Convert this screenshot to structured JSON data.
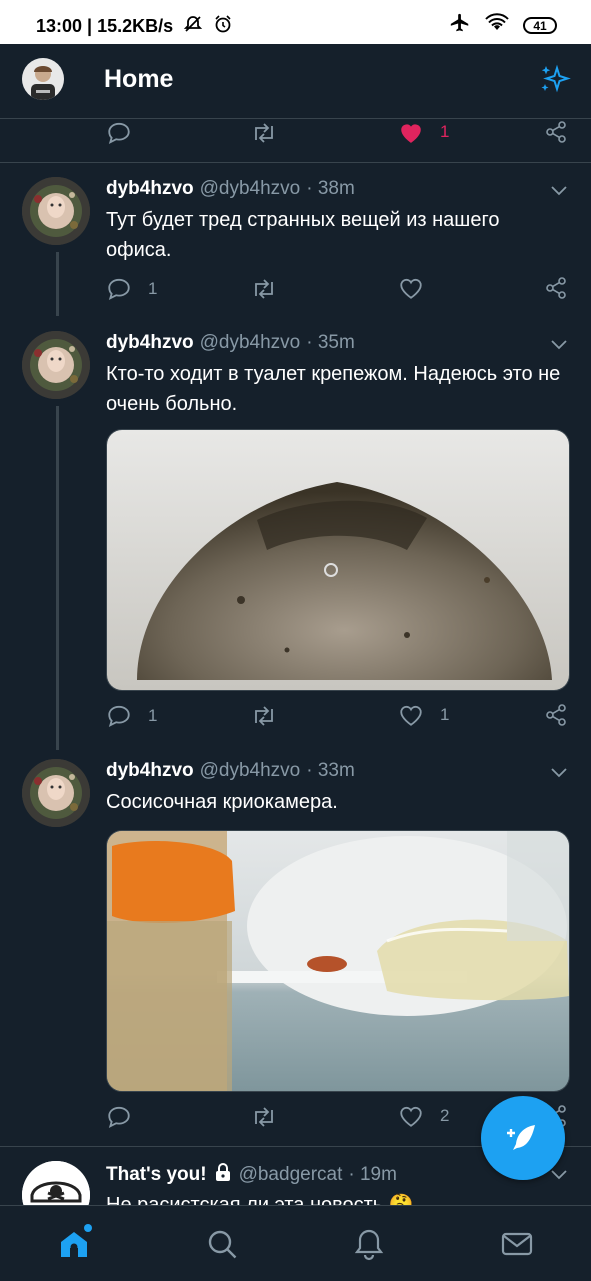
{
  "status_bar": {
    "time_speed": "13:00 | 15.2KB/s",
    "battery": "41",
    "icons": [
      "muted-bell-icon",
      "alarm-icon",
      "airplane-icon",
      "wifi-icon",
      "battery-icon"
    ]
  },
  "header": {
    "title": "Home",
    "icons": [
      "profile-avatar",
      "sparkle-icon"
    ]
  },
  "top_actions": {
    "like_count": "1"
  },
  "tweets": [
    {
      "name": "dyb4hzvo",
      "handle": "@dyb4hzvo",
      "time": "· 38m",
      "text": "Тут будет тред странных вещей из нашего офиса.",
      "reply_count": "1",
      "retweet_count": "",
      "like_count": ""
    },
    {
      "name": "dyb4hzvo",
      "handle": "@dyb4hzvo",
      "time": "· 35m",
      "text": "Кто-то ходит в туалет крепежом. Надеюсь это не очень больно.",
      "reply_count": "1",
      "retweet_count": "",
      "like_count": "1"
    },
    {
      "name": "dyb4hzvo",
      "handle": "@dyb4hzvo",
      "time": "· 33m",
      "text": "Сосисочная криокамера.",
      "reply_count": "",
      "retweet_count": "",
      "like_count": "2"
    },
    {
      "name": "That's you!",
      "handle": "@badgercat",
      "time": "· 19m",
      "text": "Не расистская ли эта новость 🤔"
    }
  ],
  "colors": {
    "background": "#15202b",
    "accent": "#1da1f2",
    "like": "#e0245e",
    "secondary_text": "#8899a6",
    "divider": "#38444d"
  },
  "bottom_nav": [
    "home-icon",
    "search-icon",
    "notifications-icon",
    "messages-icon"
  ]
}
